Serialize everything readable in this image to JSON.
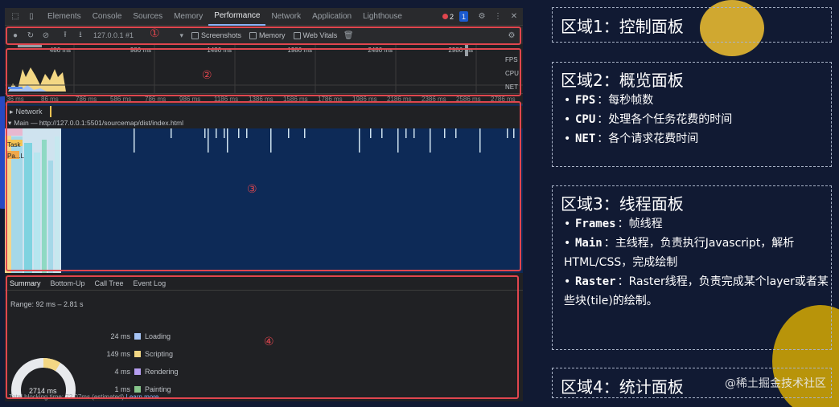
{
  "devtools": {
    "tabs": [
      "Elements",
      "Console",
      "Sources",
      "Memory",
      "Performance",
      "Network",
      "Application",
      "Lighthouse"
    ],
    "active_tab": "Performance",
    "error_count": "2",
    "message_count": "1",
    "toolbar": {
      "url_select": "127.0.0.1 #1",
      "screenshots_label": "Screenshots",
      "memory_label": "Memory",
      "web_vitals_label": "Web Vitals"
    },
    "overview": {
      "ticks": [
        "486 ms",
        "986 ms",
        "1486 ms",
        "1986 ms",
        "2486 ms",
        "2986 ms"
      ],
      "fps_label": "FPS",
      "cpu_label": "CPU",
      "net_label": "NET"
    },
    "ruler_ticks": [
      "36 ms",
      "86 ms",
      "786 ms",
      "586 ms",
      "786 ms",
      "986 ms",
      "1186 ms",
      "1386 ms",
      "1586 ms",
      "1786 ms",
      "1986 ms",
      "2186 ms",
      "2386 ms",
      "2586 ms",
      "2786 ms"
    ],
    "threads": {
      "network_label": "Network",
      "main_label": "Main — http://127.0.0.1:5501/sourcemap/dist/index.html",
      "task_label": "Task",
      "pa_label": "Pa...L"
    },
    "summary": {
      "tabs": [
        "Summary",
        "Bottom-Up",
        "Call Tree",
        "Event Log"
      ],
      "range": "Range: 92 ms – 2.81 s",
      "items": [
        {
          "value": "24 ms",
          "label": "Loading",
          "color": "#a6c4f5"
        },
        {
          "value": "149 ms",
          "label": "Scripting",
          "color": "#f3d784"
        },
        {
          "value": "4 ms",
          "label": "Rendering",
          "color": "#b69ef0"
        },
        {
          "value": "1 ms",
          "label": "Painting",
          "color": "#87c68b"
        }
      ],
      "total": "2714 ms",
      "footer": "Total blocking time: 72.07ms (estimated)",
      "learn_more": "Learn more"
    },
    "regions": [
      "①",
      "②",
      "③",
      "④"
    ]
  },
  "notes": [
    {
      "title": "区域1：控制面板",
      "items": []
    },
    {
      "title": "区域2：概览面板",
      "items": [
        {
          "key": "FPS",
          "text": "：每秒帧数"
        },
        {
          "key": "CPU",
          "text": "：处理各个任务花费的时间"
        },
        {
          "key": "NET",
          "text": "：各个请求花费时间"
        }
      ]
    },
    {
      "title": "区域3：线程面板",
      "items": [
        {
          "key": "Frames",
          "text": "：帧线程"
        },
        {
          "key": "Main",
          "text": "：主线程，负责执行Javascript，解析HTML/CSS，完成绘制"
        },
        {
          "key": "Raster",
          "text": "：Raster线程，负责完成某个layer或者某些块(tile)的绘制。"
        }
      ]
    },
    {
      "title": "区域4：统计面板",
      "items": []
    }
  ],
  "watermark": "@稀土掘金技术社区"
}
